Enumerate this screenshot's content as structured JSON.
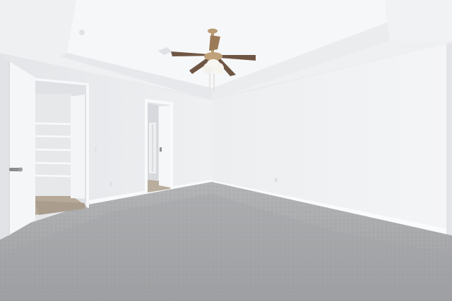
{
  "scene": {
    "colors": {
      "ceiling": "#f2f3f5",
      "tray_ceiling": "#f7f8f9",
      "wall_left": "#eceef0",
      "wall_right": "#f1f2f4",
      "wall_far_left": "#e4e6e9",
      "baseboard": "#fbfbfc",
      "carpet": "#a8a9ab",
      "carpet_dark": "#8f9093",
      "door": "#f6f7f8",
      "closet_interior": "#e2e4e7",
      "floor_wood": "#b5a899",
      "fan_blade": "#7a5a45",
      "fan_metal": "#b89a72",
      "light_glass": "#f3efe6"
    }
  }
}
